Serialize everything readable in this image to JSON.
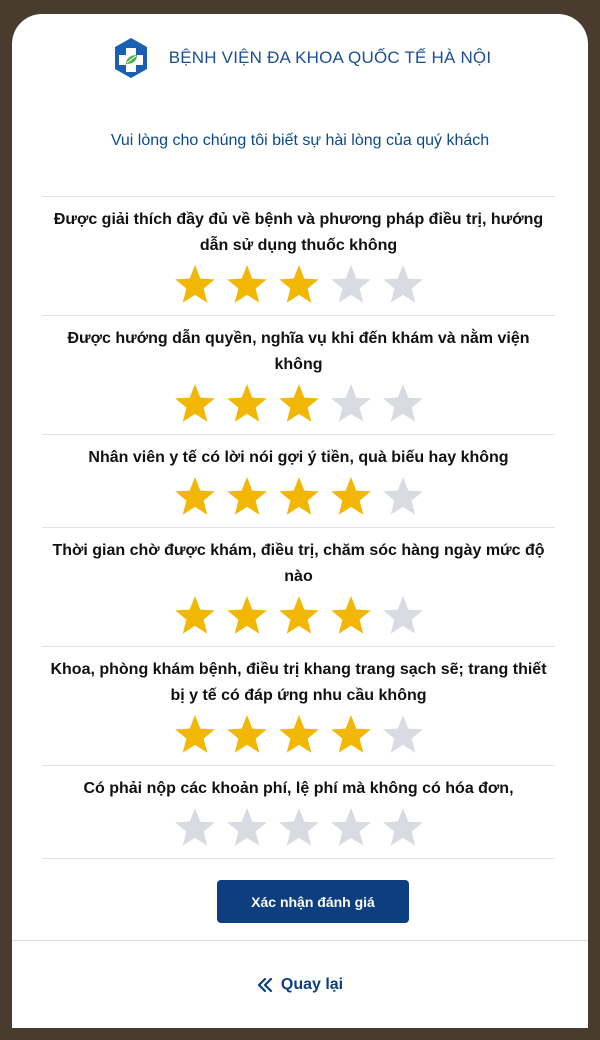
{
  "header": {
    "hospital_name": "BỆNH VIỆN ĐA KHOA QUỐC TẾ HÀ NỘI",
    "logo_icon": "hospital-cross-leaf-icon"
  },
  "prompt": "Vui lòng cho chúng tôi biết sự hài lòng của quý khách",
  "colors": {
    "primary": "#0d3f80",
    "star_filled": "#f2b705",
    "star_empty": "#d8dbe2"
  },
  "questions": [
    {
      "text": "Được giải thích đầy đủ về bệnh và phương pháp điều trị, hướng dẫn sử dụng thuốc không",
      "rating": 3,
      "max": 5
    },
    {
      "text": "Được hướng dẫn quyền, nghĩa vụ khi đến khám và nằm viện không",
      "rating": 3,
      "max": 5
    },
    {
      "text": "Nhân viên y tế có lời nói gợi ý tiền, quà biếu hay không",
      "rating": 4,
      "max": 5
    },
    {
      "text": "Thời gian chờ được khám, điều trị, chăm sóc hàng ngày mức độ nào",
      "rating": 4,
      "max": 5
    },
    {
      "text": "Khoa, phòng khám bệnh, điều trị khang trang sạch sẽ; trang thiết bị y tế có đáp ứng nhu cầu không",
      "rating": 4,
      "max": 5
    },
    {
      "text": "Có phải nộp các khoản phí, lệ phí mà không có hóa đơn,",
      "rating": 0,
      "max": 5
    }
  ],
  "confirm_label": "Xác nhận đánh giá",
  "back_label": "Quay lại",
  "back_icon": "double-chevron-left-icon"
}
